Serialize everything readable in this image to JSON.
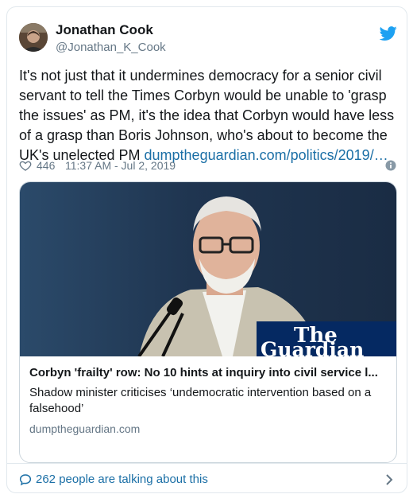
{
  "user": {
    "name": "Jonathan Cook",
    "handle": "@Jonathan_K_Cook"
  },
  "tweet": {
    "text": "It's not just that it undermines democracy for a senior civil servant to tell the Times Corbyn would be unable to 'grasp the issues' as PM, it's the idea that Corbyn would have less of a grasp than Boris Johnson, who's about to become the UK's unelected PM ",
    "link": "dumptheguardian.com/politics/2019/…",
    "likes": "446",
    "timestamp": "11:37 AM - Jul 2, 2019"
  },
  "card": {
    "logo_line1": "The",
    "logo_line2": "Guardian",
    "title": "Corbyn 'frailty' row: No 10 hints at inquiry into civil service l...",
    "description": "Shadow minister criticises ‘undemocratic intervention based on a falsehood’",
    "domain": "dumptheguardian.com"
  },
  "footer": {
    "talking": "262 people are talking about this"
  },
  "colors": {
    "twitter_blue": "#1da1f2",
    "link": "#1b6fa6",
    "guardian_navy": "#052962"
  }
}
